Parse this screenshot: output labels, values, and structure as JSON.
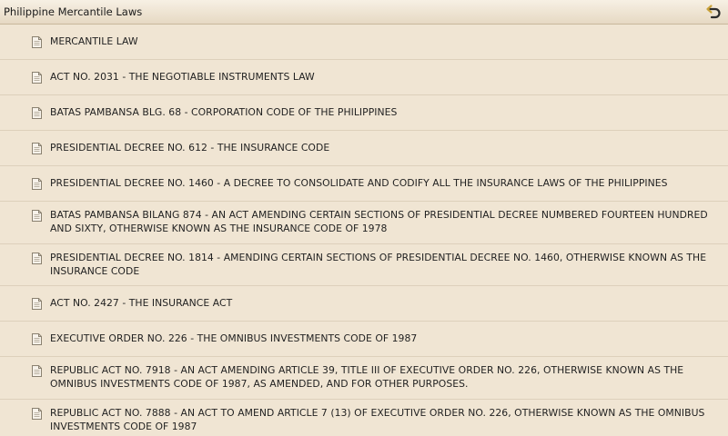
{
  "header": {
    "title": "Philippine Mercantile Laws",
    "back_icon": "undo-arrow-icon",
    "accent_color": "#c9a23a"
  },
  "list": {
    "item_icon": "document-icon",
    "items": [
      {
        "label": "MERCANTILE LAW"
      },
      {
        "label": "ACT NO. 2031 - THE NEGOTIABLE INSTRUMENTS LAW"
      },
      {
        "label": "BATAS PAMBANSA BLG. 68 - CORPORATION CODE OF THE PHILIPPINES"
      },
      {
        "label": "PRESIDENTIAL DECREE NO. 612 - THE INSURANCE CODE"
      },
      {
        "label": "PRESIDENTIAL DECREE NO. 1460 - A DECREE TO CONSOLIDATE AND CODIFY ALL THE INSURANCE LAWS OF THE PHILIPPINES"
      },
      {
        "label": "BATAS PAMBANSA BILANG 874 - AN ACT AMENDING CERTAIN SECTIONS OF PRESIDENTIAL DECREE NUMBERED FOURTEEN HUNDRED AND SIXTY, OTHERWISE KNOWN AS THE INSURANCE CODE OF 1978"
      },
      {
        "label": "PRESIDENTIAL DECREE NO. 1814 - AMENDING CERTAIN SECTIONS OF PRESIDENTIAL DECREE NO. 1460, OTHERWISE KNOWN AS THE INSURANCE CODE"
      },
      {
        "label": "ACT NO. 2427 - THE INSURANCE ACT"
      },
      {
        "label": "EXECUTIVE ORDER NO. 226 - THE OMNIBUS INVESTMENTS CODE OF 1987"
      },
      {
        "label": "REPUBLIC ACT NO. 7918 - AN ACT AMENDING ARTICLE 39, TITLE III OF EXECUTIVE ORDER NO. 226, OTHERWISE KNOWN AS THE OMNIBUS INVESTMENTS CODE OF 1987, AS AMENDED, AND FOR OTHER PURPOSES."
      },
      {
        "label": "REPUBLIC ACT NO. 7888 - AN ACT TO AMEND ARTICLE 7 (13) OF EXECUTIVE ORDER NO. 226, OTHERWISE KNOWN AS THE OMNIBUS INVESTMENTS CODE OF 1987"
      }
    ]
  }
}
